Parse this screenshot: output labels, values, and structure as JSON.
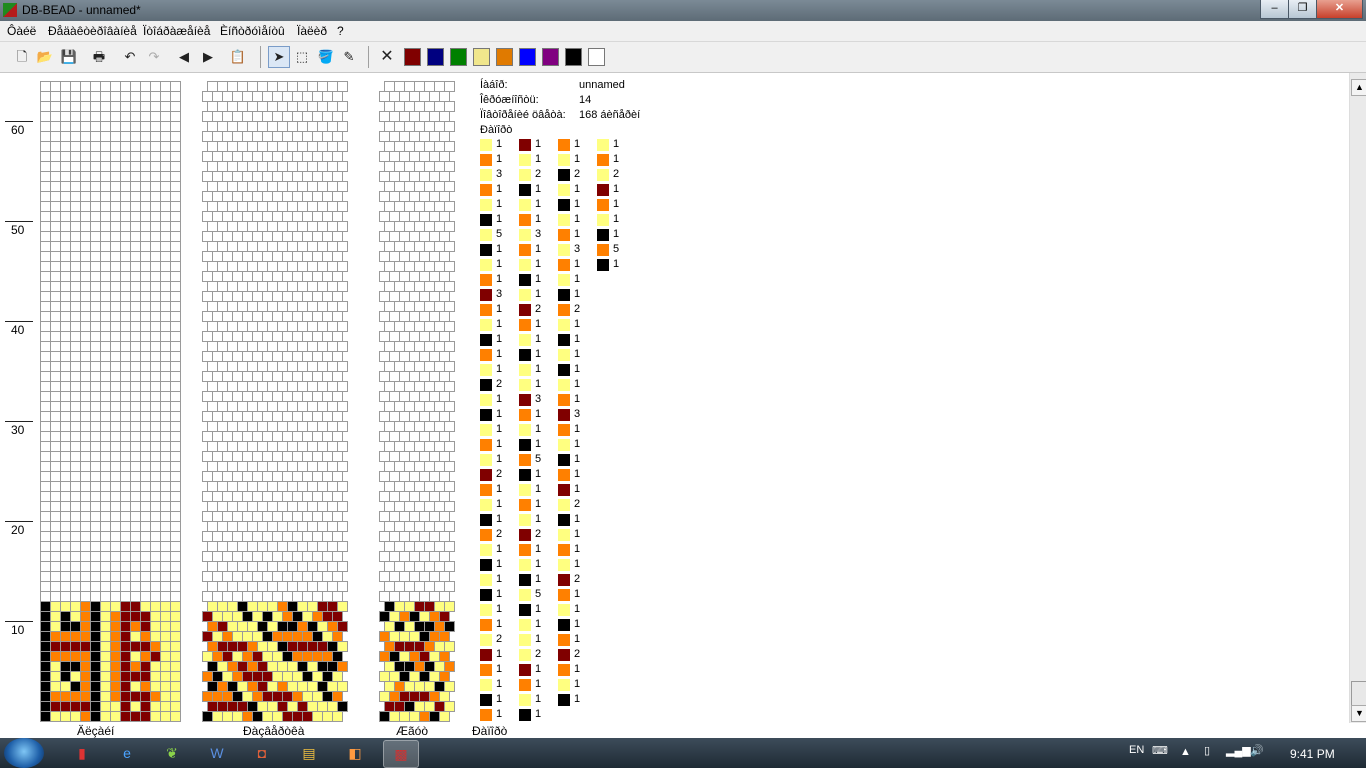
{
  "window": {
    "title": "DB-BEAD - unnamed*",
    "minimize_glyph": "–",
    "maximize_glyph": "❐",
    "close_glyph": "✕"
  },
  "menu": [
    "Ôàéë",
    "Ðåäàêòèðîâàíèå",
    "Ïòîáðàæåíèå",
    "Èíñòðóìåíòû",
    "Ïàëèð",
    "?"
  ],
  "toolbar": {
    "icons": [
      "new-file-icon",
      "open-folder-icon",
      "save-icon",
      "print-icon",
      "undo-icon",
      "redo-icon",
      "arrow-left-icon",
      "arrow-right-icon",
      "paste-icon",
      "pointer-icon",
      "select-rect-icon",
      "fill-bucket-icon",
      "eyedropper-icon",
      "clear-color-icon"
    ],
    "palette": [
      "#800000",
      "#000080",
      "#008000",
      "#f0e68c",
      "#e07a00",
      "#0000ff",
      "#800080",
      "#000000",
      "#ffffff"
    ]
  },
  "ruler": {
    "labels": [
      "60",
      "50",
      "40",
      "30",
      "20",
      "10"
    ]
  },
  "panels": {
    "left_label": "Äëçàéí",
    "middle_label": "Ðàçâåðòêà",
    "right_label": "Æãóò",
    "list_label": "Ðàïîðò"
  },
  "colors": {
    "Y": "#ffff80",
    "O": "#ff8000",
    "D": "#800000",
    "K": "#000000"
  },
  "info": {
    "name_label": "Íàáîð:",
    "name_value": "unnamed",
    "circ_label": "Îêðóæíîñòü:",
    "circ_value": "14",
    "repeat_label": "Ïîâòîðåíèé öâåòà:",
    "repeat_value": "168 áèñåðèí",
    "report_label": "Ðàïîðò"
  },
  "legend": [
    [
      [
        "Y",
        "1"
      ],
      [
        "O",
        "1"
      ],
      [
        "Y",
        "3"
      ],
      [
        "O",
        "1"
      ],
      [
        "Y",
        "1"
      ],
      [
        "K",
        "1"
      ],
      [
        "Y",
        "5"
      ],
      [
        "K",
        "1"
      ],
      [
        "Y",
        "1"
      ],
      [
        "O",
        "1"
      ],
      [
        "D",
        "3"
      ],
      [
        "O",
        "1"
      ],
      [
        "Y",
        "1"
      ],
      [
        "K",
        "1"
      ],
      [
        "O",
        "1"
      ],
      [
        "Y",
        "1"
      ],
      [
        "K",
        "2"
      ],
      [
        "Y",
        "1"
      ],
      [
        "K",
        "1"
      ],
      [
        "Y",
        "1"
      ],
      [
        "O",
        "1"
      ],
      [
        "Y",
        "1"
      ],
      [
        "D",
        "2"
      ],
      [
        "O",
        "1"
      ],
      [
        "Y",
        "1"
      ],
      [
        "K",
        "1"
      ],
      [
        "O",
        "2"
      ],
      [
        "Y",
        "1"
      ],
      [
        "K",
        "1"
      ],
      [
        "Y",
        "1"
      ],
      [
        "K",
        "1"
      ],
      [
        "Y",
        "1"
      ],
      [
        "O",
        "1"
      ],
      [
        "Y",
        "2"
      ],
      [
        "D",
        "1"
      ],
      [
        "O",
        "1"
      ],
      [
        "Y",
        "1"
      ],
      [
        "K",
        "1"
      ],
      [
        "O",
        "1"
      ]
    ],
    [
      [
        "D",
        "1"
      ],
      [
        "Y",
        "1"
      ],
      [
        "Y",
        "2"
      ],
      [
        "K",
        "1"
      ],
      [
        "Y",
        "1"
      ],
      [
        "O",
        "1"
      ],
      [
        "Y",
        "3"
      ],
      [
        "O",
        "1"
      ],
      [
        "Y",
        "1"
      ],
      [
        "K",
        "1"
      ],
      [
        "Y",
        "1"
      ],
      [
        "D",
        "2"
      ],
      [
        "O",
        "1"
      ],
      [
        "Y",
        "1"
      ],
      [
        "K",
        "1"
      ],
      [
        "Y",
        "1"
      ],
      [
        "Y",
        "1"
      ],
      [
        "D",
        "3"
      ],
      [
        "O",
        "1"
      ],
      [
        "Y",
        "1"
      ],
      [
        "K",
        "1"
      ],
      [
        "O",
        "5"
      ],
      [
        "K",
        "1"
      ],
      [
        "Y",
        "1"
      ],
      [
        "O",
        "1"
      ],
      [
        "Y",
        "1"
      ],
      [
        "D",
        "2"
      ],
      [
        "O",
        "1"
      ],
      [
        "Y",
        "1"
      ],
      [
        "K",
        "1"
      ],
      [
        "Y",
        "5"
      ],
      [
        "K",
        "1"
      ],
      [
        "Y",
        "1"
      ],
      [
        "Y",
        "1"
      ],
      [
        "Y",
        "2"
      ],
      [
        "D",
        "1"
      ],
      [
        "O",
        "1"
      ],
      [
        "Y",
        "1"
      ],
      [
        "K",
        "1"
      ]
    ],
    [
      [
        "O",
        "1"
      ],
      [
        "Y",
        "1"
      ],
      [
        "K",
        "2"
      ],
      [
        "Y",
        "1"
      ],
      [
        "K",
        "1"
      ],
      [
        "Y",
        "1"
      ],
      [
        "O",
        "1"
      ],
      [
        "Y",
        "3"
      ],
      [
        "O",
        "1"
      ],
      [
        "Y",
        "1"
      ],
      [
        "K",
        "1"
      ],
      [
        "O",
        "2"
      ],
      [
        "Y",
        "1"
      ],
      [
        "K",
        "1"
      ],
      [
        "Y",
        "1"
      ],
      [
        "K",
        "1"
      ],
      [
        "Y",
        "1"
      ],
      [
        "O",
        "1"
      ],
      [
        "D",
        "3"
      ],
      [
        "O",
        "1"
      ],
      [
        "Y",
        "1"
      ],
      [
        "K",
        "1"
      ],
      [
        "O",
        "1"
      ],
      [
        "D",
        "1"
      ],
      [
        "Y",
        "2"
      ],
      [
        "K",
        "1"
      ],
      [
        "Y",
        "1"
      ],
      [
        "O",
        "1"
      ],
      [
        "Y",
        "1"
      ],
      [
        "D",
        "2"
      ],
      [
        "O",
        "1"
      ],
      [
        "Y",
        "1"
      ],
      [
        "K",
        "1"
      ],
      [
        "O",
        "1"
      ],
      [
        "D",
        "2"
      ],
      [
        "O",
        "1"
      ],
      [
        "Y",
        "1"
      ],
      [
        "K",
        "1"
      ]
    ],
    [
      [
        "Y",
        "1"
      ],
      [
        "O",
        "1"
      ],
      [
        "Y",
        "2"
      ],
      [
        "D",
        "1"
      ],
      [
        "O",
        "1"
      ],
      [
        "Y",
        "1"
      ],
      [
        "K",
        "1"
      ],
      [
        "O",
        "5"
      ],
      [
        "K",
        "1"
      ]
    ]
  ],
  "pattern": [
    [
      "K",
      "Y",
      "Y",
      "Y",
      "O",
      "K",
      "Y",
      "Y",
      "D",
      "D",
      "Y",
      "Y",
      "Y",
      "Y"
    ],
    [
      "K",
      "Y",
      "K",
      "Y",
      "O",
      "K",
      "Y",
      "O",
      "D",
      "D",
      "D",
      "Y",
      "Y",
      "Y"
    ],
    [
      "K",
      "Y",
      "K",
      "K",
      "O",
      "K",
      "Y",
      "O",
      "D",
      "O",
      "D",
      "Y",
      "Y",
      "Y"
    ],
    [
      "K",
      "O",
      "O",
      "O",
      "O",
      "K",
      "Y",
      "O",
      "D",
      "Y",
      "O",
      "Y",
      "Y",
      "Y"
    ],
    [
      "K",
      "D",
      "D",
      "D",
      "D",
      "K",
      "Y",
      "O",
      "D",
      "D",
      "D",
      "O",
      "Y",
      "Y"
    ],
    [
      "K",
      "O",
      "O",
      "O",
      "O",
      "K",
      "Y",
      "O",
      "D",
      "Y",
      "O",
      "D",
      "Y",
      "Y"
    ],
    [
      "K",
      "Y",
      "K",
      "K",
      "O",
      "K",
      "Y",
      "O",
      "D",
      "O",
      "D",
      "Y",
      "Y",
      "Y"
    ],
    [
      "K",
      "Y",
      "K",
      "Y",
      "O",
      "K",
      "Y",
      "O",
      "D",
      "D",
      "D",
      "Y",
      "Y",
      "Y"
    ],
    [
      "K",
      "Y",
      "Y",
      "K",
      "O",
      "K",
      "Y",
      "O",
      "D",
      "Y",
      "O",
      "Y",
      "Y",
      "Y"
    ],
    [
      "K",
      "O",
      "O",
      "O",
      "O",
      "K",
      "Y",
      "O",
      "D",
      "D",
      "D",
      "O",
      "Y",
      "Y"
    ],
    [
      "K",
      "D",
      "D",
      "D",
      "D",
      "K",
      "Y",
      "Y",
      "D",
      "Y",
      "D",
      "Y",
      "Y",
      "Y"
    ],
    [
      "K",
      "Y",
      "Y",
      "Y",
      "O",
      "K",
      "Y",
      "Y",
      "D",
      "D",
      "D",
      "Y",
      "Y",
      "Y"
    ]
  ],
  "status": {
    "lang": "EN",
    "time": "9:41 PM"
  },
  "taskbar": [
    "book-app-icon",
    "ie-icon",
    "leaf-app-icon",
    "word-icon",
    "pdf-app-icon",
    "explorer-icon",
    "paint-app-icon",
    "dbbead-app-icon"
  ]
}
